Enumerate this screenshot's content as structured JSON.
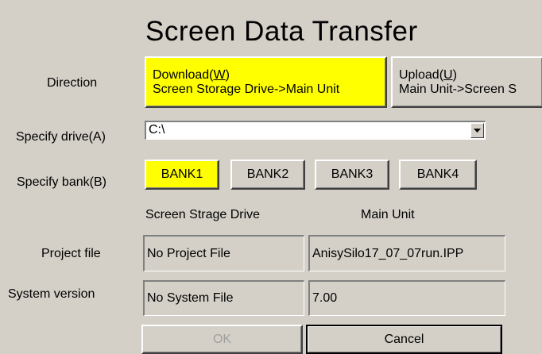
{
  "title": "Screen Data Transfer",
  "direction": {
    "label": "Direction",
    "download": {
      "line1": "Download(W)",
      "line2": "Screen Storage Drive->Main Unit",
      "selected": true
    },
    "upload": {
      "line1": "Upload(U)",
      "line2": "Main Unit->Screen S",
      "selected": false
    }
  },
  "drive": {
    "label": "Specify drive(A)",
    "value": "C:\\"
  },
  "bank": {
    "label": "Specify bank(B)",
    "options": [
      "BANK1",
      "BANK2",
      "BANK3",
      "BANK4"
    ],
    "selected": "BANK1"
  },
  "columns": {
    "left": "Screen Strage Drive",
    "right": "Main Unit"
  },
  "project_file": {
    "label": "Project file",
    "storage": "No Project File",
    "main_unit": "AnisySilo17_07_07run.IPP"
  },
  "system_version": {
    "label": "System version",
    "storage": "No System File",
    "main_unit": "7.00"
  },
  "buttons": {
    "ok": "OK",
    "cancel": "Cancel"
  },
  "colors": {
    "selected": "#ffff00",
    "background": "#d4d0c8"
  }
}
